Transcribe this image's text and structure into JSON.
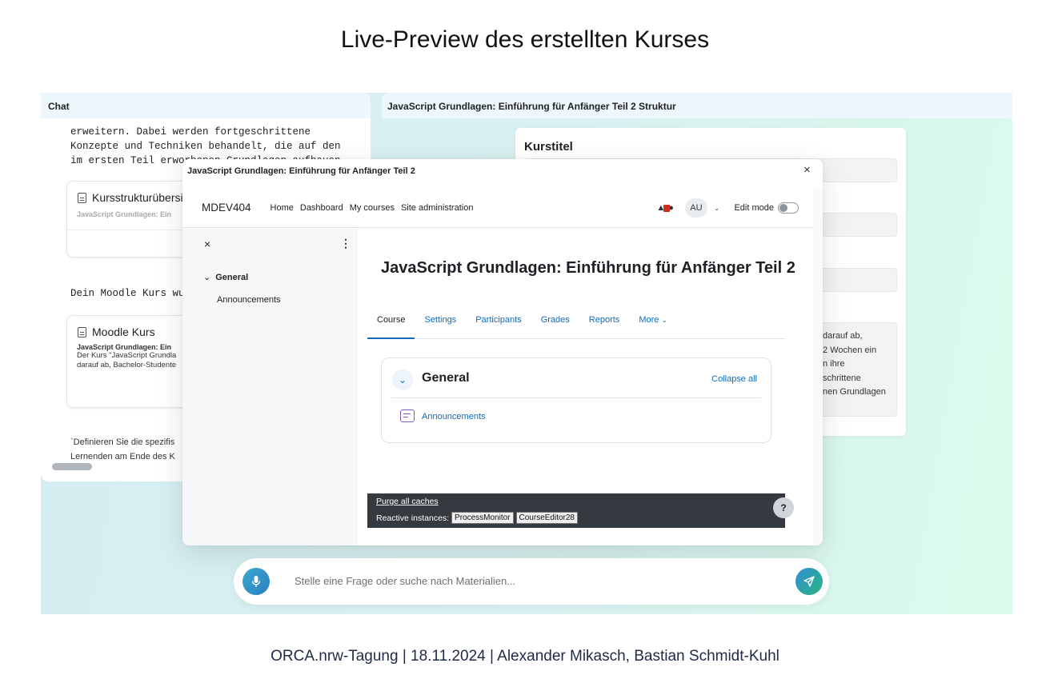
{
  "slide": {
    "title": "Live-Preview des erstellten Kurses",
    "footer": "ORCA.nrw-Tagung | 18.11.2024 | Alexander Mikasch, Bastian Schmidt-Kuhl"
  },
  "chat": {
    "header": "Chat",
    "intro_text": "erweitern. Dabei werden fortgeschrittene\nKonzepte und Techniken behandelt, die auf den\nim ersten Teil erworbenen Grundlagen aufbauen",
    "card1": {
      "title": "Kursstrukturübersic",
      "subtitle": "JavaScript Grundlagen: Ein"
    },
    "moodle_text": "Dein Moodle Kurs wur",
    "card2": {
      "title": "Moodle Kurs",
      "subtitle": "JavaScript Grundlagen: Ein",
      "body_line1": "Der Kurs \"JavaScript Grundla",
      "body_line2": "darauf ab, Bachelor-Studente"
    },
    "prompt_line1": "`Definieren Sie die spezifis",
    "prompt_line2": "Lernenden am Ende des K"
  },
  "structure": {
    "header": "JavaScript Grundlagen: Einführung für Anfänger Teil 2 Struktur",
    "form_label": "Kurstitel",
    "title_value": "JavaScript Grundlagen: Einführung für Anfänger Teil 2",
    "description_lines": [
      "darauf ab,",
      "2 Wochen ein",
      "n ihre",
      "schrittene",
      "nen Grundlagen"
    ]
  },
  "modal": {
    "title": "JavaScript Grundlagen: Einführung für Anfänger Teil 2",
    "close": "×"
  },
  "moodle": {
    "brand": "MDEV404",
    "nav": [
      "Home",
      "Dashboard",
      "My courses",
      "Site administration"
    ],
    "avatar": "AU",
    "edit_mode": "Edit mode",
    "drawer": {
      "close": "×",
      "menu": "⋮",
      "section": "General",
      "item": "Announcements"
    },
    "course_title": "JavaScript Grundlagen: Einführung für Anfänger Teil 2",
    "tabs": [
      "Course",
      "Settings",
      "Participants",
      "Grades",
      "Reports",
      "More"
    ],
    "section_title": "General",
    "collapse_all": "Collapse all",
    "activity": "Announcements",
    "footer": {
      "purge": "Purge all caches",
      "reactive_label": "Reactive instances:",
      "instances": [
        "ProcessMonitor",
        "CourseEditor28"
      ]
    },
    "help": "?"
  },
  "chat_input": {
    "placeholder": "Stelle eine Frage oder suche nach Materialien..."
  },
  "colors": {
    "moodle_blue": "#0f6cbf",
    "app_bg_start": "#d5eef2",
    "app_bg_end": "#dcfbec",
    "mic_gradient": "#2a7fc0",
    "send_gradient": "#2bb580"
  }
}
